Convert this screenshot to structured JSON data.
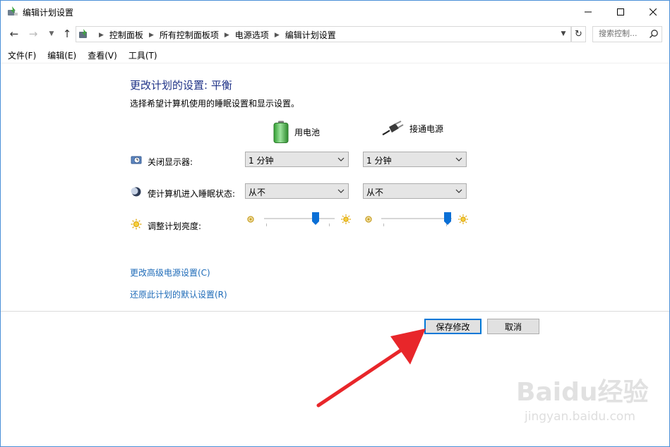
{
  "window": {
    "title": "编辑计划设置"
  },
  "address": {
    "crumbs": [
      "控制面板",
      "所有控制面板项",
      "电源选项",
      "编辑计划设置"
    ],
    "search_placeholder": "搜索控制..."
  },
  "menu": [
    "文件(F)",
    "编辑(E)",
    "查看(V)",
    "工具(T)"
  ],
  "content": {
    "heading": "更改计划的设置: 平衡",
    "subtext": "选择希望计算机使用的睡眠设置和显示设置。",
    "col_battery": "用电池",
    "col_plugged": "接通电源",
    "rows": {
      "display": {
        "label": "关闭显示器:",
        "battery": "1 分钟",
        "plugged": "1 分钟"
      },
      "sleep": {
        "label": "使计算机进入睡眠状态:",
        "battery": "从不",
        "plugged": "从不"
      },
      "brightness": {
        "label": "调整计划亮度:",
        "battery_level": 0.75,
        "plugged_level": 0.99
      }
    },
    "links": {
      "advanced": "更改高级电源设置(C)",
      "restore": "还原此计划的默认设置(R)"
    }
  },
  "buttons": {
    "save": "保存修改",
    "cancel": "取消"
  },
  "colors": {
    "heading": "#1e3287",
    "link": "#1e6bb8",
    "accent": "#0078d7",
    "annotation_arrow": "#e8262a"
  },
  "watermark": {
    "logo": "Baidu经验",
    "url": "jingyan.baidu.com"
  }
}
